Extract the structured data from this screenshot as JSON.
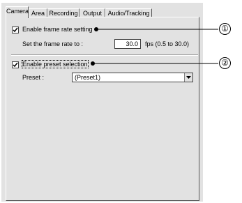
{
  "tabs": [
    {
      "label": "Camera",
      "active": true
    },
    {
      "label": "Area",
      "active": false
    },
    {
      "label": "Recording",
      "active": false
    },
    {
      "label": "Output",
      "active": false
    },
    {
      "label": "Audio/Tracking",
      "active": false
    }
  ],
  "frame_rate": {
    "checkbox_label": "Enable frame rate setting",
    "checked": true,
    "set_label": "Set the frame rate to :",
    "value": "30.0",
    "unit_hint": "fps (0.5 to 30.0)"
  },
  "preset": {
    "checkbox_label": "Enable preset selection",
    "checked": true,
    "label": "Preset :",
    "selected": "(Preset1)"
  },
  "callouts": [
    "①",
    "②"
  ],
  "colors": {
    "panel_bg": "#e2e2e2",
    "field_bg": "#ffffff"
  }
}
